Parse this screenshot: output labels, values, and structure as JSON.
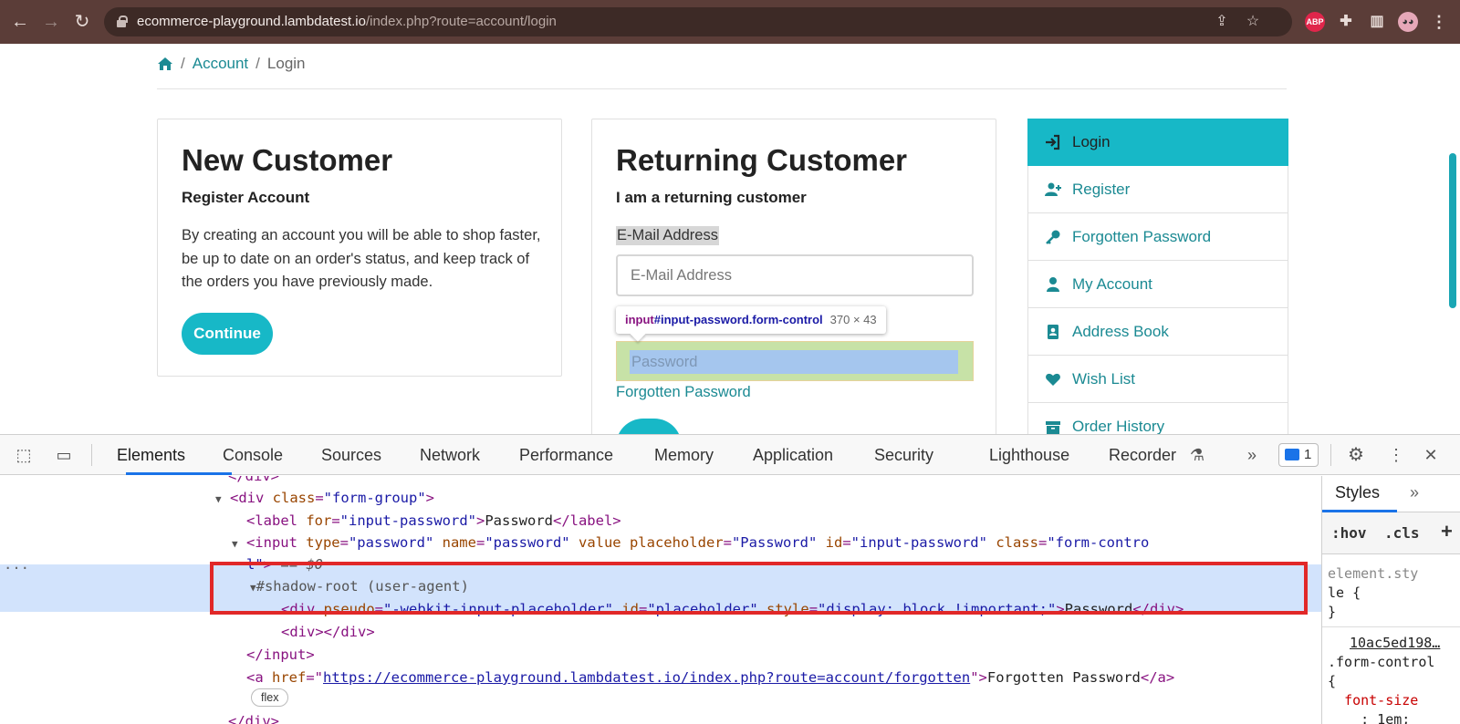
{
  "browser": {
    "url_host": "ecommerce-playground.lambdatest.io",
    "url_path": "/index.php?route=account/login",
    "extension_abp": "ABP"
  },
  "breadcrumb": {
    "items": [
      {
        "label": "Account"
      },
      {
        "label": "Login"
      }
    ],
    "separator": "/"
  },
  "new_customer": {
    "title": "New Customer",
    "subtitle": "Register Account",
    "body": "By creating an account you will be able to shop faster, be up to date on an order's status, and keep track of the orders you have previously made.",
    "continue_label": "Continue"
  },
  "returning_customer": {
    "title": "Returning Customer",
    "subtitle": "I am a returning customer",
    "email_label": "E-Mail Address",
    "email_placeholder": "E-Mail Address",
    "tooltip_tag": "input",
    "tooltip_selector": "#input-password.form-control",
    "tooltip_dims": "370 × 43",
    "password_placeholder": "Password",
    "forgot_label": "Forgotten Password"
  },
  "sidebar": {
    "items": [
      {
        "label": "Login",
        "icon": "sign-in-icon",
        "active": true
      },
      {
        "label": "Register",
        "icon": "user-plus-icon"
      },
      {
        "label": "Forgotten Password",
        "icon": "key-icon"
      },
      {
        "label": "My Account",
        "icon": "user-icon"
      },
      {
        "label": "Address Book",
        "icon": "address-book-icon"
      },
      {
        "label": "Wish List",
        "icon": "heart-icon"
      },
      {
        "label": "Order History",
        "icon": "box-icon"
      }
    ]
  },
  "devtools": {
    "tabs": [
      "Elements",
      "Console",
      "Sources",
      "Network",
      "Performance",
      "Memory",
      "Application",
      "Security",
      "Lighthouse",
      "Recorder"
    ],
    "issues_count": "1",
    "code": {
      "line0": "</div>",
      "line1_tag": "div",
      "line1_attr": "class",
      "line1_val": "\"form-group\"",
      "line2_label_attr": "for",
      "line2_label_val": "\"input-password\"",
      "line2_label_text": "Password",
      "line3_type": "\"password\"",
      "line3_name": "\"password\"",
      "line3_placeholder": "\"Password\"",
      "line3_id": "\"input-password\"",
      "line3_class_a": "\"form-contro",
      "line3_class_b": "l\"",
      "line3_eq": "== $0",
      "line4": "#shadow-root (user-agent)",
      "line5_pseudo": "\"-webkit-input-placeholder\"",
      "line5_id": "\"placeholder\"",
      "line5_style": "\"display: block !important;\"",
      "line5_text": "Password",
      "line6": "<div></div>",
      "line7": "</input>",
      "line8_href": "https://ecommerce-playground.lambdatest.io/index.php?route=account/forgotten",
      "line8_text": "Forgotten Password",
      "flex_badge": "flex",
      "line9": "</div>",
      "gutter_dots": "..."
    },
    "styles": {
      "tab_label": "Styles",
      "hov": ":hov",
      "cls": ".cls",
      "element_style_a": "element.sty",
      "element_style_b": "le {",
      "element_style_c": "}",
      "source_link": "10ac5ed198…",
      "rule_selector": ".form-control",
      "rule_open": "{",
      "prop": "font-size",
      "prop_val": ": 1em;"
    }
  }
}
